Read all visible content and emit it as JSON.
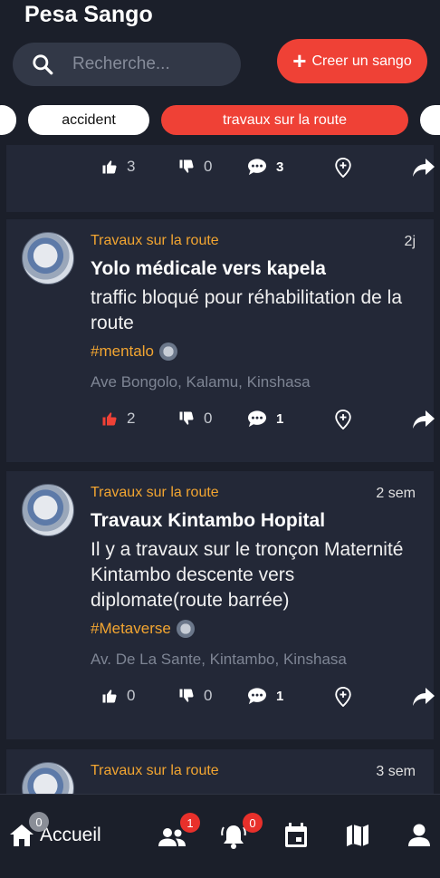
{
  "app": {
    "title": "Pesa Sango"
  },
  "search": {
    "placeholder": "Recherche..."
  },
  "create_button": {
    "label": "Creer un sango"
  },
  "filters": [
    {
      "label": "accident",
      "active": false
    },
    {
      "label": "travaux sur la route",
      "active": true
    }
  ],
  "partial_top": {
    "likes": "3",
    "dislikes": "0",
    "comments": "3"
  },
  "posts": [
    {
      "category": "Travaux sur la route",
      "time": "2j",
      "title": "Yolo médicale vers kapela",
      "body": "traffic bloqué pour réhabilitation de la route",
      "hashtag": "#mentalo",
      "location": "Ave Bongolo, Kalamu, Kinshasa",
      "likes": "2",
      "liked": true,
      "dislikes": "0",
      "comments": "1"
    },
    {
      "category": "Travaux sur la route",
      "time": "2 sem",
      "title": "Travaux Kintambo Hopital",
      "body": "Il y a travaux sur le tronçon Maternité Kintambo descente vers diplomate(route barrée)",
      "hashtag": "#Metaverse",
      "location": "Av. De La Sante, Kintambo, Kinshasa",
      "likes": "0",
      "liked": false,
      "dislikes": "0",
      "comments": "1"
    },
    {
      "category": "Travaux sur la route",
      "time": "3 sem"
    }
  ],
  "bottom_nav": {
    "home_label": "Accueil",
    "home_badge": "0",
    "friends_badge": "1",
    "notifications_badge": "0"
  },
  "colors": {
    "accent": "#ef4136",
    "category": "#f2a531",
    "background": "#1b1f2a",
    "card": "#232837"
  }
}
